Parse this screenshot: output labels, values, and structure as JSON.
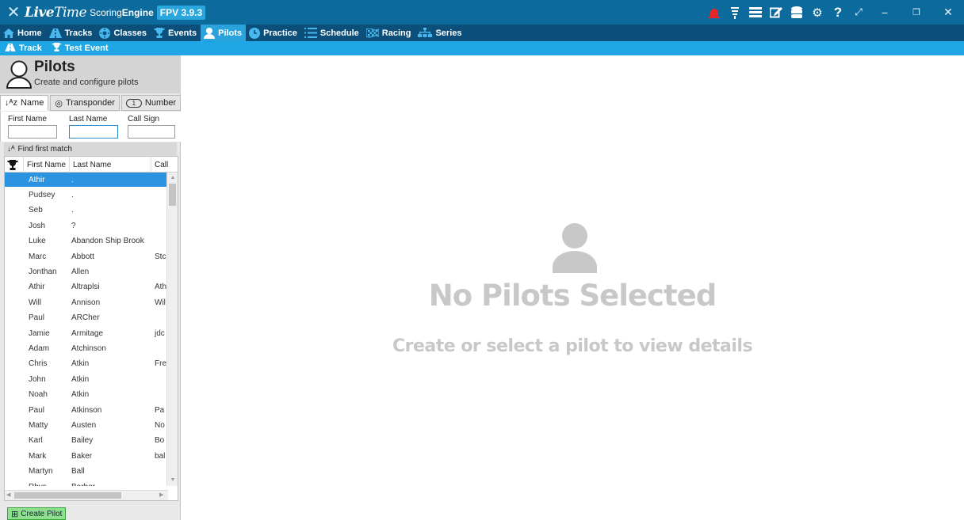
{
  "app": {
    "logo_live": "Live",
    "logo_time": "Time",
    "product_plain": "Scoring",
    "product_bold": "Engine",
    "version": "FPV 3.9.3"
  },
  "titlebar_icons": [
    "siren-icon",
    "transponder-icon",
    "list-icon",
    "edit-icon",
    "database-icon",
    "gear-icon",
    "help-icon",
    "expand-icon"
  ],
  "window_controls": [
    "minimize-button",
    "restore-button",
    "close-button"
  ],
  "nav": [
    {
      "label": "Home",
      "icon": "home-icon"
    },
    {
      "label": "Tracks",
      "icon": "tracks-icon"
    },
    {
      "label": "Classes",
      "icon": "classes-icon"
    },
    {
      "label": "Events",
      "icon": "trophy-icon"
    },
    {
      "label": "Pilots",
      "icon": "pilot-icon",
      "active": true
    },
    {
      "label": "Practice",
      "icon": "clock-icon"
    },
    {
      "label": "Schedule",
      "icon": "schedule-icon"
    },
    {
      "label": "Racing",
      "icon": "checkered-flag-icon"
    },
    {
      "label": "Series",
      "icon": "series-icon"
    }
  ],
  "subnav": [
    {
      "label": "Track",
      "icon": "tracks-icon"
    },
    {
      "label": "Test Event",
      "icon": "trophy-icon"
    }
  ],
  "panel": {
    "title": "Pilots",
    "subtitle": "Create and configure pilots"
  },
  "sort_tabs": [
    {
      "label": "Name",
      "icon": "sort-az-icon",
      "active": true
    },
    {
      "label": "Transponder",
      "icon": "transponder-icon"
    },
    {
      "label": "Number",
      "icon": "number-icon",
      "badge": "1"
    }
  ],
  "filters": {
    "first_name_label": "First Name",
    "last_name_label": "Last Name",
    "call_sign_label": "Call Sign",
    "first_name_value": "",
    "last_name_value": "",
    "call_sign_value": ""
  },
  "find_first_match": "Find first match",
  "table": {
    "columns": [
      "",
      "First Name",
      "Last Name",
      "Call"
    ],
    "rows": [
      {
        "first": "Athir",
        "last": ".",
        "call": ""
      },
      {
        "first": "Pudsey",
        "last": ".",
        "call": ""
      },
      {
        "first": "Seb",
        "last": ".",
        "call": ""
      },
      {
        "first": "Josh",
        "last": "?",
        "call": ""
      },
      {
        "first": "Luke",
        "last": "Abandon Ship Brook",
        "call": ""
      },
      {
        "first": "Marc",
        "last": "Abbott",
        "call": "Stc"
      },
      {
        "first": "Jonthan",
        "last": "Allen",
        "call": ""
      },
      {
        "first": "Athir",
        "last": "Altraplsi",
        "call": "Ath"
      },
      {
        "first": "Will",
        "last": "Annison",
        "call": "Wil"
      },
      {
        "first": "Paul",
        "last": "ARCher",
        "call": ""
      },
      {
        "first": "Jamie",
        "last": "Armitage",
        "call": "jdc"
      },
      {
        "first": "Adam",
        "last": "Atchinson",
        "call": ""
      },
      {
        "first": "Chris",
        "last": "Atkin",
        "call": "Fre"
      },
      {
        "first": "John",
        "last": "Atkin",
        "call": ""
      },
      {
        "first": "Noah",
        "last": "Atkin",
        "call": ""
      },
      {
        "first": "Paul",
        "last": "Atkinson",
        "call": "Pa"
      },
      {
        "first": "Matty",
        "last": "Austen",
        "call": "No"
      },
      {
        "first": "Karl",
        "last": "Bailey",
        "call": "Bo"
      },
      {
        "first": "Mark",
        "last": "Baker",
        "call": "bal"
      },
      {
        "first": "Martyn",
        "last": "Ball",
        "call": ""
      },
      {
        "first": "Rhys",
        "last": "Barber",
        "call": ""
      }
    ]
  },
  "create_button": "Create Pilot",
  "empty_state": {
    "title": "No Pilots Selected",
    "subtitle": "Create or select a pilot to view details"
  },
  "colors": {
    "titlebar": "#0d6a9c",
    "nav": "#0b4f7a",
    "subnav": "#1ea7e4",
    "selected_row": "#2b93df",
    "create_button": "#8ee08e",
    "siren": "#e8262a"
  }
}
